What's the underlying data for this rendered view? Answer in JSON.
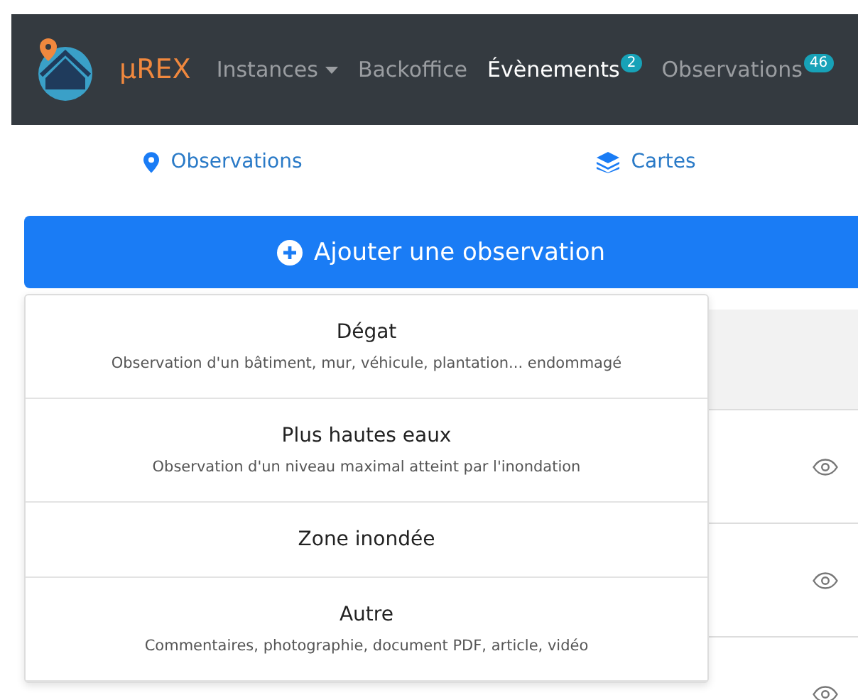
{
  "navbar": {
    "brand": "µREX",
    "items": [
      {
        "label": "Instances",
        "selected": false,
        "dropdown": true
      },
      {
        "label": "Backoffice",
        "selected": false
      },
      {
        "label": "Évènements",
        "selected": true,
        "badge": "2"
      },
      {
        "label": "Observations",
        "selected": false,
        "badge": "46"
      }
    ]
  },
  "tabs": [
    {
      "label": "Observations"
    },
    {
      "label": "Cartes"
    }
  ],
  "add_button": {
    "label": "Ajouter une observation"
  },
  "dropdown_menu": [
    {
      "title": "Dégat",
      "description": "Observation d'un bâtiment, mur, véhicule, plantation... endommagé"
    },
    {
      "title": "Plus hautes eaux",
      "description": "Observation d'un niveau maximal atteint par l'inondation"
    },
    {
      "title": "Zone inondée"
    },
    {
      "title": "Autre",
      "description": "Commentaires, photographie, document PDF, article, vidéo"
    }
  ]
}
